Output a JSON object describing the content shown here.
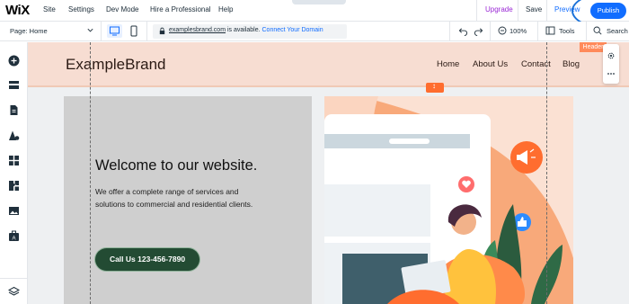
{
  "topbar": {
    "logo": "WiX",
    "menu": [
      "Site",
      "Settings",
      "Dev Mode",
      "Hire a Professional",
      "Help"
    ],
    "upgrade": "Upgrade",
    "save": "Save",
    "preview": "Preview",
    "publish": "Publish"
  },
  "toolbar": {
    "page_label": "Page: Home",
    "domain_name": "examplesbrand.com",
    "domain_status": " is available. ",
    "domain_link": "Connect Your Domain",
    "zoom": "100%",
    "tools": "Tools",
    "search": "Search"
  },
  "sidebar": {
    "icons": [
      "add-icon",
      "sections-icon",
      "pages-icon",
      "theme-icon",
      "apps-icon",
      "business-apps-icon",
      "media-icon",
      "portfolio-icon",
      "layers-icon"
    ]
  },
  "site": {
    "brand": "ExampleBrand",
    "nav": [
      "Home",
      "About Us",
      "Contact",
      "Blog"
    ],
    "header_tag": "Header",
    "hero_title": "Welcome to our website.",
    "hero_body": "We offer a complete range of services and solutions to commercial and residential clients.",
    "cta": "Call Us 123-456-7890"
  },
  "colors": {
    "accent": "#116dff",
    "upgrade": "#9a27d5",
    "header_bg": "#f7ddd2",
    "cta_bg": "#234b33",
    "handle": "#ff6d2f"
  }
}
